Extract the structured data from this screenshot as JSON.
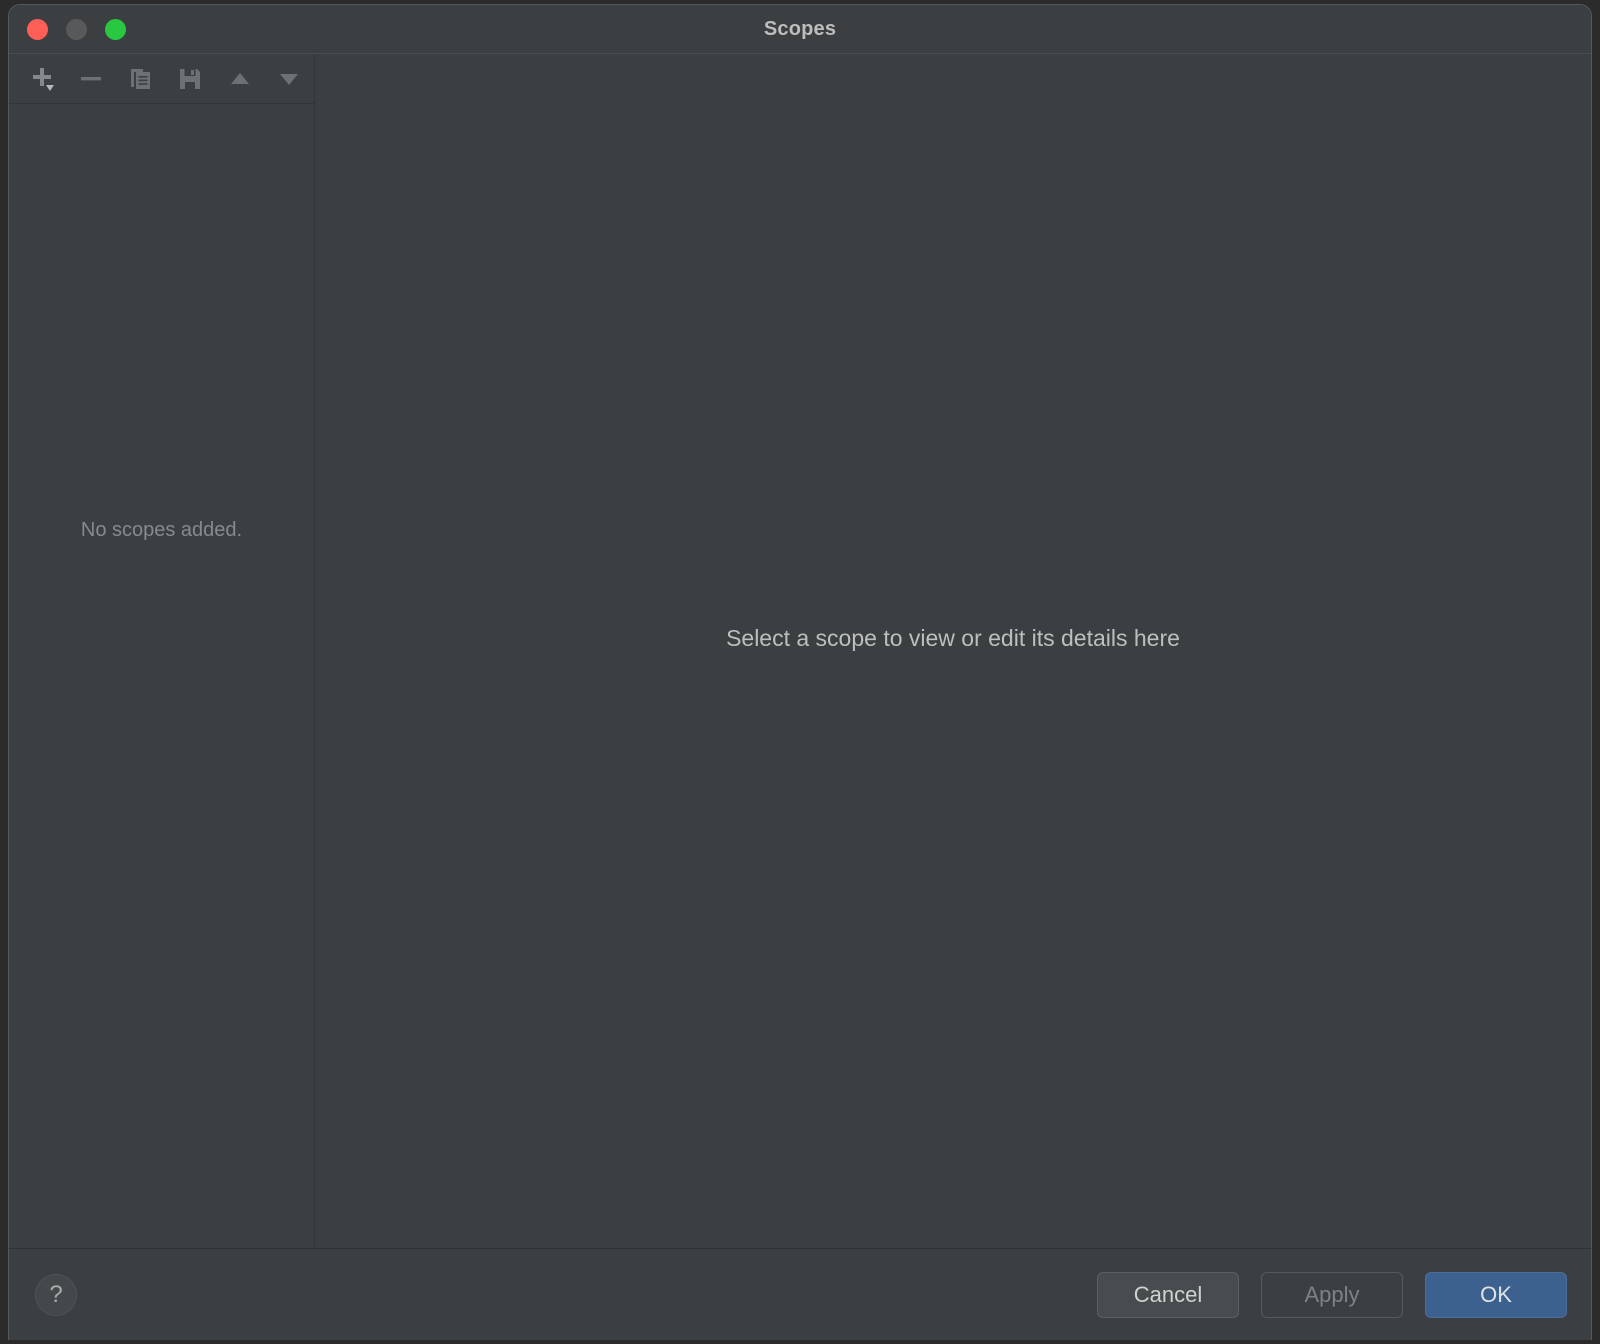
{
  "window": {
    "title": "Scopes",
    "traffic_lights": [
      {
        "name": "close",
        "color": "#ff5f57"
      },
      {
        "name": "minimize",
        "color": "#58595a"
      },
      {
        "name": "maximize",
        "color": "#28c840"
      }
    ]
  },
  "sidebar": {
    "toolbar": [
      {
        "icon": "add-icon",
        "label": "Add scope",
        "has_dropdown": true,
        "enabled": true
      },
      {
        "icon": "remove-icon",
        "label": "Remove scope",
        "enabled": false
      },
      {
        "icon": "copy-icon",
        "label": "Duplicate scope",
        "enabled": false
      },
      {
        "icon": "save-icon",
        "label": "Save scope",
        "enabled": false
      },
      {
        "icon": "move-up-icon",
        "label": "Move up",
        "enabled": false
      },
      {
        "icon": "move-down-icon",
        "label": "Move down",
        "enabled": false
      }
    ],
    "empty_text": "No scopes added."
  },
  "main": {
    "empty_text": "Select a scope to view or edit its details here"
  },
  "footer": {
    "help_label": "?",
    "cancel_label": "Cancel",
    "apply_label": "Apply",
    "ok_label": "OK"
  },
  "colors": {
    "window_background": "#3c3f41",
    "border": "#55595b",
    "divider": "#323537",
    "text_primary": "#bcbfc0",
    "text_muted": "#868a8c",
    "icon": "#7d8183",
    "primary_button": "#3d618f"
  }
}
